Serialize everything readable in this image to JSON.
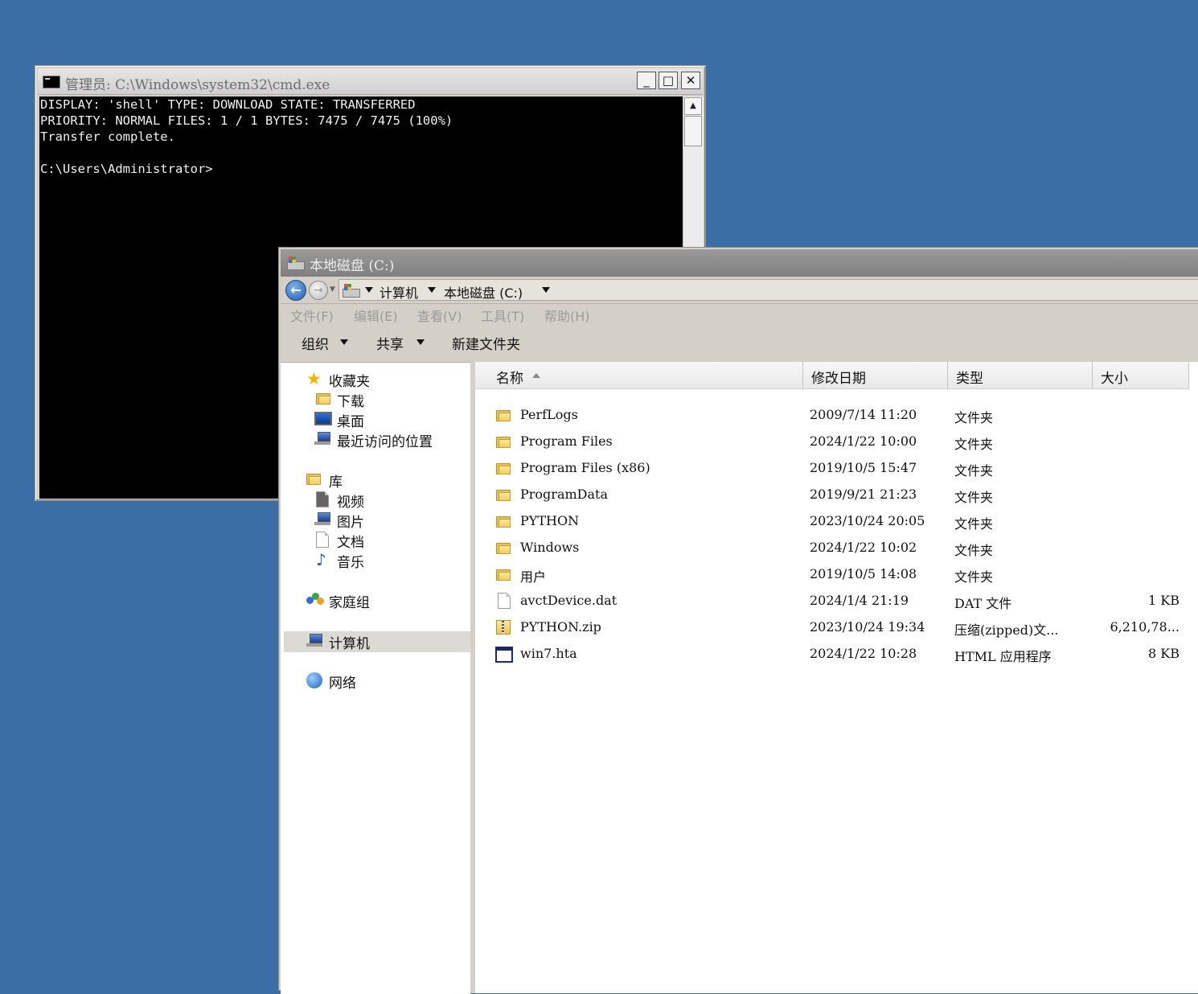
{
  "cmd": {
    "title": "管理员: C:\\Windows\\system32\\cmd.exe",
    "lines": [
      "DISPLAY: 'shell' TYPE: DOWNLOAD STATE: TRANSFERRED",
      "PRIORITY: NORMAL FILES: 1 / 1 BYTES: 7475 / 7475 (100%)",
      "Transfer complete.",
      "",
      "C:\\Users\\Administrator>"
    ],
    "buttons": {
      "minimize": "_",
      "maximize": "□",
      "close": "✕"
    }
  },
  "explorer": {
    "title": "本地磁盘 (C:)",
    "address": {
      "computer": "计算机",
      "drive": "本地磁盘 (C:)"
    },
    "menu": [
      "文件(F)",
      "编辑(E)",
      "查看(V)",
      "工具(T)",
      "帮助(H)"
    ],
    "toolbar": {
      "organize": "组织",
      "share": "共享",
      "new_folder": "新建文件夹"
    },
    "nav": {
      "favorites": "收藏夹",
      "downloads": "下载",
      "desktop": "桌面",
      "recent": "最近访问的位置",
      "libraries": "库",
      "videos": "视频",
      "pictures": "图片",
      "documents": "文档",
      "music": "音乐",
      "homegroup": "家庭组",
      "computer": "计算机",
      "network": "网络"
    },
    "columns": {
      "name": "名称",
      "date": "修改日期",
      "type": "类型",
      "size": "大小"
    },
    "files": [
      {
        "name": "PerfLogs",
        "date": "2009/7/14 11:20",
        "type": "文件夹",
        "size": "",
        "icon": "folder-icon"
      },
      {
        "name": "Program Files",
        "date": "2024/1/22 10:00",
        "type": "文件夹",
        "size": "",
        "icon": "folder-icon"
      },
      {
        "name": "Program Files (x86)",
        "date": "2019/10/5 15:47",
        "type": "文件夹",
        "size": "",
        "icon": "folder-icon"
      },
      {
        "name": "ProgramData",
        "date": "2019/9/21 21:23",
        "type": "文件夹",
        "size": "",
        "icon": "folder-icon"
      },
      {
        "name": "PYTHON",
        "date": "2023/10/24 20:05",
        "type": "文件夹",
        "size": "",
        "icon": "folder-icon"
      },
      {
        "name": "Windows",
        "date": "2024/1/22 10:02",
        "type": "文件夹",
        "size": "",
        "icon": "folder-icon"
      },
      {
        "name": "用户",
        "date": "2019/10/5 14:08",
        "type": "文件夹",
        "size": "",
        "icon": "folder-icon"
      },
      {
        "name": "avctDevice.dat",
        "date": "2024/1/4 21:19",
        "type": "DAT 文件",
        "size": "1 KB",
        "icon": "file-icon"
      },
      {
        "name": "PYTHON.zip",
        "date": "2023/10/24 19:34",
        "type": "压缩(zipped)文...",
        "size": "6,210,78...",
        "icon": "zip-icon"
      },
      {
        "name": "win7.hta",
        "date": "2024/1/22 10:28",
        "type": "HTML 应用程序",
        "size": "8 KB",
        "icon": "hta-icon"
      }
    ]
  },
  "colors": {
    "desktop": "#3a6ea5",
    "console_bg": "#000000",
    "console_fg": "#f0f0f0"
  }
}
